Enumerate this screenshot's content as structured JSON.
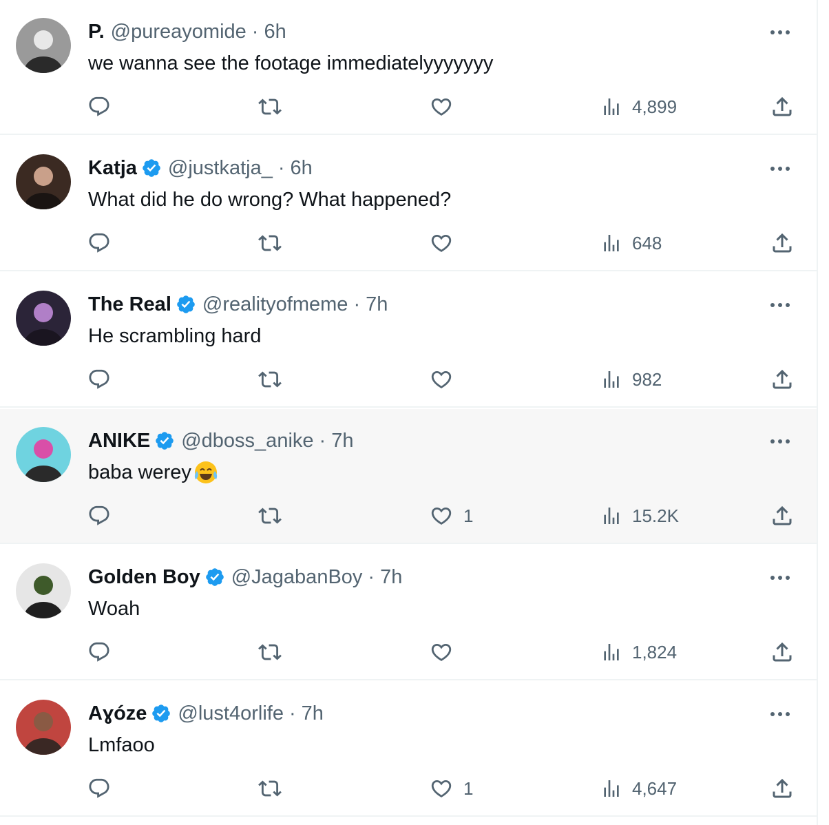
{
  "tweets": [
    {
      "name": "P.",
      "verified": false,
      "handle": "@pureayomide",
      "time": "6h",
      "text": "we wanna see the footage immediatelyyyyyyy",
      "likes": "",
      "views": "4,899",
      "avatar_colors": [
        "#9a9a9a",
        "#e8e8e8",
        "#2a2a2a"
      ]
    },
    {
      "name": "Katja",
      "verified": true,
      "handle": "@justkatja_",
      "time": "6h",
      "text": "What did he do wrong? What happened?",
      "likes": "",
      "views": "648",
      "avatar_colors": [
        "#3b2a22",
        "#c9a08a",
        "#1a1412"
      ]
    },
    {
      "name": "The Real",
      "verified": true,
      "handle": "@realityofmeme",
      "time": "7h",
      "text": "He scrambling hard",
      "likes": "",
      "views": "982",
      "avatar_colors": [
        "#2b2438",
        "#b07fc7",
        "#1a1520"
      ]
    },
    {
      "name": "ANIKE",
      "verified": true,
      "handle": "@dboss_anike",
      "time": "7h",
      "text": "baba werey",
      "emoji": "face-with-tears-of-joy",
      "likes": "1",
      "views": "15.2K",
      "highlighted": true,
      "avatar_colors": [
        "#6fd3e0",
        "#d94fa8",
        "#2a2a2a"
      ]
    },
    {
      "name": "Golden Boy",
      "verified": true,
      "handle": "@JagabanBoy",
      "time": "7h",
      "text": "Woah",
      "likes": "",
      "views": "1,824",
      "avatar_colors": [
        "#e6e6e6",
        "#3e5a2a",
        "#1f1f1f"
      ]
    },
    {
      "name": "Aɣóze",
      "verified": true,
      "handle": "@lust4orlife",
      "time": "7h",
      "text": "Lmfaoo",
      "likes": "1",
      "views": "4,647",
      "avatar_colors": [
        "#c0453f",
        "#8a5a44",
        "#3a2824"
      ]
    }
  ],
  "theme": {
    "verified_color": "#1d9bf0",
    "muted_text": "#536471",
    "divider": "#eff3f4",
    "highlight_bg": "#f7f7f7"
  }
}
